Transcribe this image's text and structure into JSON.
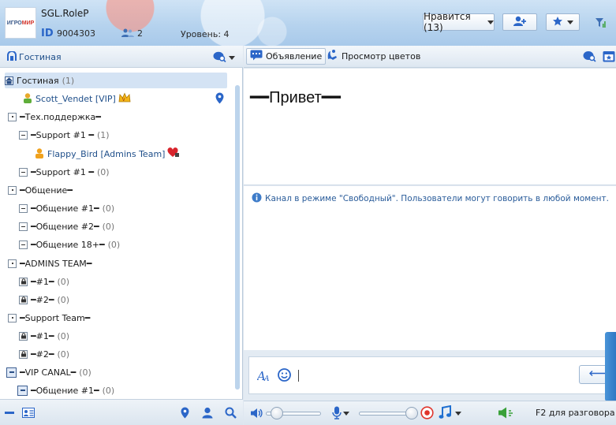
{
  "header": {
    "logo_text_1": "ИГРО",
    "logo_text_2": "МИР",
    "nickname": "SGL.RoleP",
    "id_label": "ID",
    "id_value": "9004303",
    "online_users": "2",
    "level": "Уровень: 4",
    "likes": "Нравится (13)"
  },
  "sidebar": {
    "room_name": "Гостиная",
    "tree": [
      {
        "kind": "room",
        "label": "Гостиная",
        "count": "(1)",
        "selected": true
      },
      {
        "kind": "user",
        "label": "Scott_Vendet [VIP]"
      },
      {
        "kind": "group",
        "label": "━Тех.поддержка━"
      },
      {
        "kind": "sub",
        "label": "━Support #1 ━",
        "count": "(1)"
      },
      {
        "kind": "user",
        "label": "Flappy_Bird [Admins Team]"
      },
      {
        "kind": "sub",
        "label": "━Support #1 ━",
        "count": "(0)"
      },
      {
        "kind": "group",
        "label": "━Общение━"
      },
      {
        "kind": "sub",
        "label": "━Общение #1━",
        "count": "(0)"
      },
      {
        "kind": "sub",
        "label": "━Общение #2━",
        "count": "(0)"
      },
      {
        "kind": "sub",
        "label": "━Общение 18+━",
        "count": "(0)"
      },
      {
        "kind": "group",
        "label": "━ADMINS TEAM━"
      },
      {
        "kind": "locked",
        "label": "━#1━",
        "count": "(0)"
      },
      {
        "kind": "locked",
        "label": "━#2━",
        "count": "(0)"
      },
      {
        "kind": "group",
        "label": "━Support Team━"
      },
      {
        "kind": "locked",
        "label": "━#1━",
        "count": "(0)"
      },
      {
        "kind": "locked",
        "label": "━#2━",
        "count": "(0)"
      },
      {
        "kind": "vip",
        "label": "━VIP CANAL━",
        "count": "(0)"
      },
      {
        "kind": "vipsub",
        "label": "━Общение #1━",
        "count": "(0)"
      }
    ]
  },
  "toolbar": {
    "announcement_tab": "Объявление",
    "flowers_tab": "Просмотр цветов"
  },
  "announcement": {
    "text": "━━Привет━━"
  },
  "chat": {
    "system_message": "Канал в режиме \"Свободный\". Пользователи могут говорить в любой момент."
  },
  "controls": {
    "push_to_talk": "F2 для разговора",
    "volume_level": 0.2,
    "mic_level": 0.98
  },
  "colors": {
    "accent": "#2b66c8",
    "link": "#1f4f8a",
    "record": "#e0342b",
    "music": "#1f6fd0",
    "speaker_green": "#3aa13a"
  }
}
